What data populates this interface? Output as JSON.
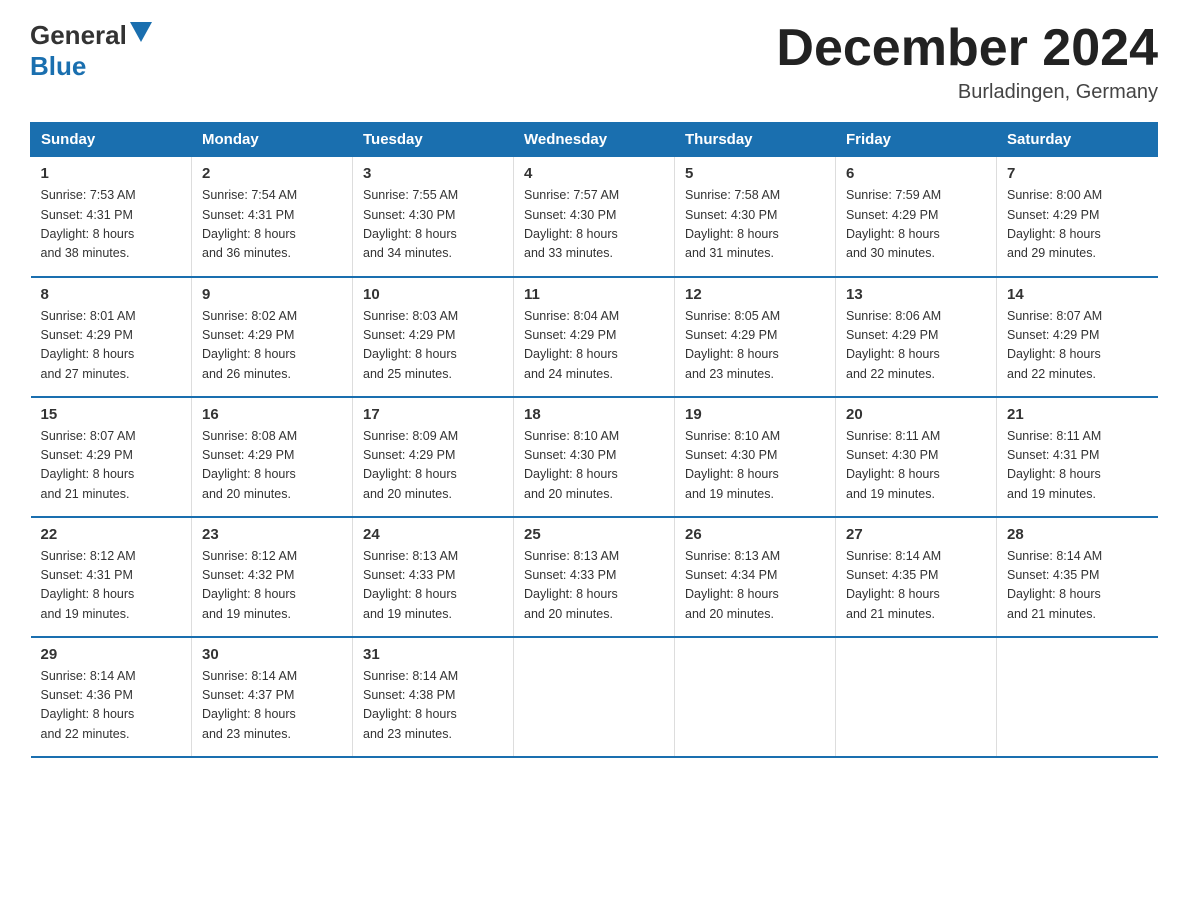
{
  "header": {
    "logo_general": "General",
    "logo_blue": "Blue",
    "title": "December 2024",
    "location": "Burladingen, Germany"
  },
  "days_of_week": [
    "Sunday",
    "Monday",
    "Tuesday",
    "Wednesday",
    "Thursday",
    "Friday",
    "Saturday"
  ],
  "weeks": [
    [
      {
        "day": "1",
        "sunrise": "7:53 AM",
        "sunset": "4:31 PM",
        "daylight": "8 hours and 38 minutes."
      },
      {
        "day": "2",
        "sunrise": "7:54 AM",
        "sunset": "4:31 PM",
        "daylight": "8 hours and 36 minutes."
      },
      {
        "day": "3",
        "sunrise": "7:55 AM",
        "sunset": "4:30 PM",
        "daylight": "8 hours and 34 minutes."
      },
      {
        "day": "4",
        "sunrise": "7:57 AM",
        "sunset": "4:30 PM",
        "daylight": "8 hours and 33 minutes."
      },
      {
        "day": "5",
        "sunrise": "7:58 AM",
        "sunset": "4:30 PM",
        "daylight": "8 hours and 31 minutes."
      },
      {
        "day": "6",
        "sunrise": "7:59 AM",
        "sunset": "4:29 PM",
        "daylight": "8 hours and 30 minutes."
      },
      {
        "day": "7",
        "sunrise": "8:00 AM",
        "sunset": "4:29 PM",
        "daylight": "8 hours and 29 minutes."
      }
    ],
    [
      {
        "day": "8",
        "sunrise": "8:01 AM",
        "sunset": "4:29 PM",
        "daylight": "8 hours and 27 minutes."
      },
      {
        "day": "9",
        "sunrise": "8:02 AM",
        "sunset": "4:29 PM",
        "daylight": "8 hours and 26 minutes."
      },
      {
        "day": "10",
        "sunrise": "8:03 AM",
        "sunset": "4:29 PM",
        "daylight": "8 hours and 25 minutes."
      },
      {
        "day": "11",
        "sunrise": "8:04 AM",
        "sunset": "4:29 PM",
        "daylight": "8 hours and 24 minutes."
      },
      {
        "day": "12",
        "sunrise": "8:05 AM",
        "sunset": "4:29 PM",
        "daylight": "8 hours and 23 minutes."
      },
      {
        "day": "13",
        "sunrise": "8:06 AM",
        "sunset": "4:29 PM",
        "daylight": "8 hours and 22 minutes."
      },
      {
        "day": "14",
        "sunrise": "8:07 AM",
        "sunset": "4:29 PM",
        "daylight": "8 hours and 22 minutes."
      }
    ],
    [
      {
        "day": "15",
        "sunrise": "8:07 AM",
        "sunset": "4:29 PM",
        "daylight": "8 hours and 21 minutes."
      },
      {
        "day": "16",
        "sunrise": "8:08 AM",
        "sunset": "4:29 PM",
        "daylight": "8 hours and 20 minutes."
      },
      {
        "day": "17",
        "sunrise": "8:09 AM",
        "sunset": "4:29 PM",
        "daylight": "8 hours and 20 minutes."
      },
      {
        "day": "18",
        "sunrise": "8:10 AM",
        "sunset": "4:30 PM",
        "daylight": "8 hours and 20 minutes."
      },
      {
        "day": "19",
        "sunrise": "8:10 AM",
        "sunset": "4:30 PM",
        "daylight": "8 hours and 19 minutes."
      },
      {
        "day": "20",
        "sunrise": "8:11 AM",
        "sunset": "4:30 PM",
        "daylight": "8 hours and 19 minutes."
      },
      {
        "day": "21",
        "sunrise": "8:11 AM",
        "sunset": "4:31 PM",
        "daylight": "8 hours and 19 minutes."
      }
    ],
    [
      {
        "day": "22",
        "sunrise": "8:12 AM",
        "sunset": "4:31 PM",
        "daylight": "8 hours and 19 minutes."
      },
      {
        "day": "23",
        "sunrise": "8:12 AM",
        "sunset": "4:32 PM",
        "daylight": "8 hours and 19 minutes."
      },
      {
        "day": "24",
        "sunrise": "8:13 AM",
        "sunset": "4:33 PM",
        "daylight": "8 hours and 19 minutes."
      },
      {
        "day": "25",
        "sunrise": "8:13 AM",
        "sunset": "4:33 PM",
        "daylight": "8 hours and 20 minutes."
      },
      {
        "day": "26",
        "sunrise": "8:13 AM",
        "sunset": "4:34 PM",
        "daylight": "8 hours and 20 minutes."
      },
      {
        "day": "27",
        "sunrise": "8:14 AM",
        "sunset": "4:35 PM",
        "daylight": "8 hours and 21 minutes."
      },
      {
        "day": "28",
        "sunrise": "8:14 AM",
        "sunset": "4:35 PM",
        "daylight": "8 hours and 21 minutes."
      }
    ],
    [
      {
        "day": "29",
        "sunrise": "8:14 AM",
        "sunset": "4:36 PM",
        "daylight": "8 hours and 22 minutes."
      },
      {
        "day": "30",
        "sunrise": "8:14 AM",
        "sunset": "4:37 PM",
        "daylight": "8 hours and 23 minutes."
      },
      {
        "day": "31",
        "sunrise": "8:14 AM",
        "sunset": "4:38 PM",
        "daylight": "8 hours and 23 minutes."
      },
      null,
      null,
      null,
      null
    ]
  ],
  "labels": {
    "sunrise": "Sunrise:",
    "sunset": "Sunset:",
    "daylight": "Daylight:"
  }
}
